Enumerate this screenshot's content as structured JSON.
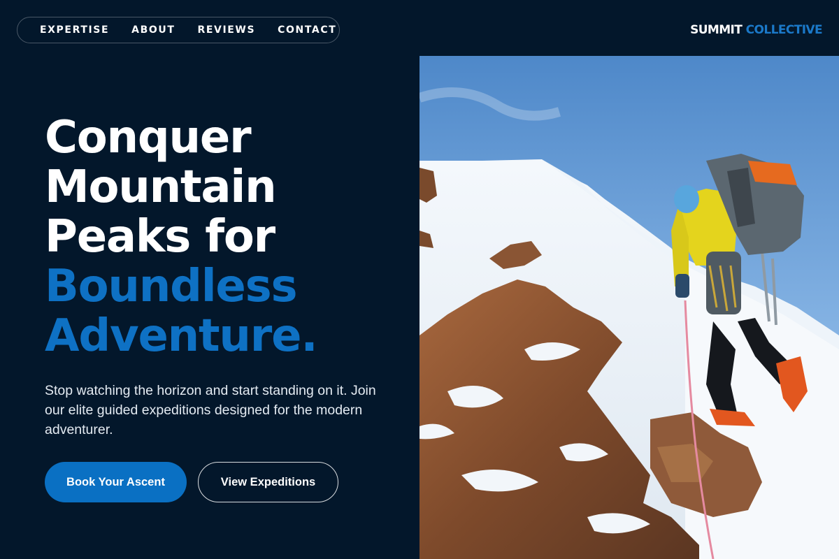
{
  "nav": {
    "items": [
      {
        "label": "EXPERTISE"
      },
      {
        "label": "ABOUT"
      },
      {
        "label": "REVIEWS"
      },
      {
        "label": "CONTACT"
      }
    ]
  },
  "brand": {
    "part1": "SUMMIT",
    "part2": "COLLECTIVE"
  },
  "hero": {
    "title_line1": "Conquer",
    "title_line2": "Mountain",
    "title_line3": "Peaks for",
    "title_accent_line1": "Boundless",
    "title_accent_line2": "Adventure.",
    "description": "Stop watching the horizon and start standing on it. Join our elite guided expeditions designed for the modern adventurer.",
    "primary_button": "Book Your Ascent",
    "secondary_button": "View Expeditions"
  },
  "colors": {
    "background": "#03172b",
    "accent": "#0e71c4",
    "button_primary": "#0a70c3"
  },
  "image": {
    "subject": "mountaineer-climbing-snowy-ridge"
  }
}
